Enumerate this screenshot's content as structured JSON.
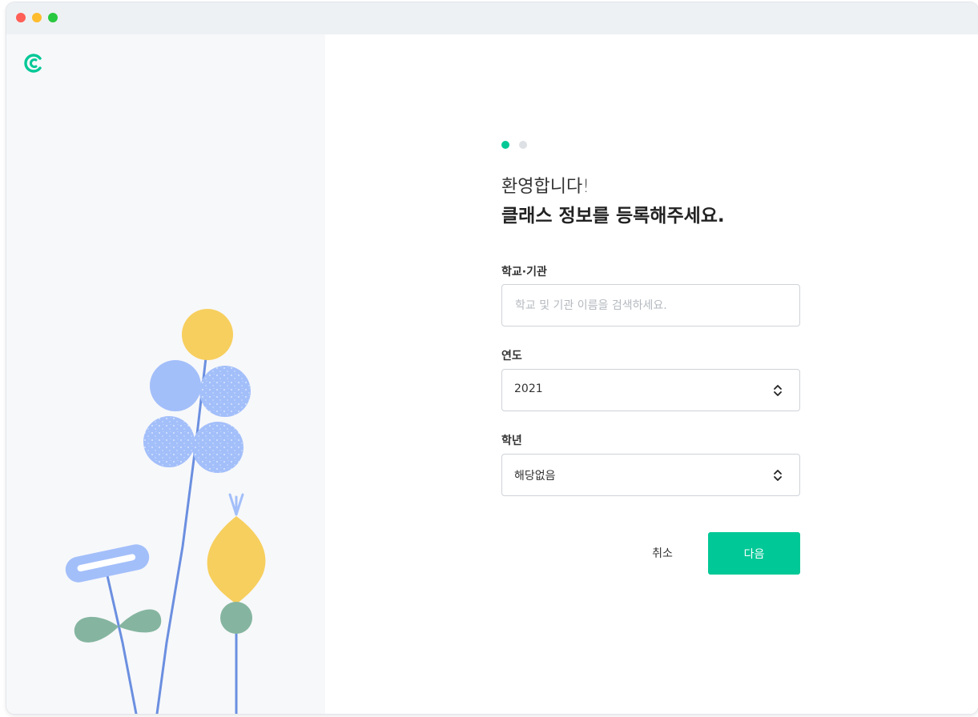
{
  "app": {
    "logo_icon": "classting-logo-icon",
    "brand_color": "#00c896"
  },
  "steps": {
    "current": 1,
    "total": 2
  },
  "heading": {
    "welcome": "환영합니다!",
    "headline": "클래스 정보를 등록해주세요."
  },
  "fields": {
    "school": {
      "label": "학교·기관",
      "placeholder": "학교 및 기관 이름을 검색하세요.",
      "value": ""
    },
    "year": {
      "label": "연도",
      "value": "2021"
    },
    "grade": {
      "label": "학년",
      "value": "해당없음"
    }
  },
  "actions": {
    "cancel_label": "취소",
    "next_label": "다음"
  },
  "illustration": {
    "colors": {
      "blue": "#a3bffa",
      "yellow": "#f7cf5e",
      "green": "#85b5a0",
      "stem": "#6b8fe0"
    }
  }
}
